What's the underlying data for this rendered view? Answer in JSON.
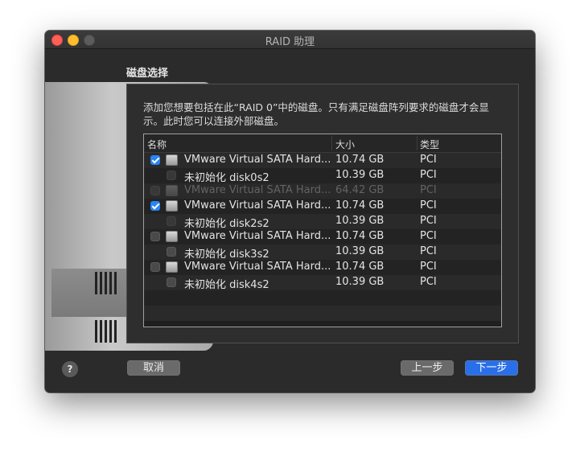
{
  "window": {
    "title": "RAID 助理"
  },
  "section_title": "磁盘选择",
  "description": "添加您想要包括在此“RAID 0”中的磁盘。只有满足磁盘阵列要求的磁盘才会显示。此时您可以连接外部磁盘。",
  "table": {
    "headers": {
      "name": "名称",
      "size": "大小",
      "type": "类型"
    },
    "rows": [
      {
        "level": 0,
        "checked": true,
        "disabled": false,
        "icon": "disk-icon",
        "name": "VMware Virtual SATA Hard...",
        "size": "10.74 GB",
        "type": "PCI"
      },
      {
        "level": 1,
        "checked": false,
        "disabled": true,
        "icon": "",
        "name": "未初始化 disk0s2",
        "size": "10.39 GB",
        "type": "PCI"
      },
      {
        "level": 0,
        "checked": false,
        "disabled": true,
        "icon": "disk-icon",
        "name": "VMware Virtual SATA Hard...",
        "size": "64.42 GB",
        "type": "PCI"
      },
      {
        "level": 0,
        "checked": true,
        "disabled": false,
        "icon": "disk-icon",
        "name": "VMware Virtual SATA Hard...",
        "size": "10.74 GB",
        "type": "PCI"
      },
      {
        "level": 1,
        "checked": false,
        "disabled": true,
        "icon": "",
        "name": "未初始化 disk2s2",
        "size": "10.39 GB",
        "type": "PCI"
      },
      {
        "level": 0,
        "checked": false,
        "disabled": false,
        "icon": "disk-icon",
        "name": "VMware Virtual SATA Hard...",
        "size": "10.74 GB",
        "type": "PCI"
      },
      {
        "level": 1,
        "checked": false,
        "disabled": false,
        "icon": "",
        "name": "未初始化 disk3s2",
        "size": "10.39 GB",
        "type": "PCI"
      },
      {
        "level": 0,
        "checked": false,
        "disabled": false,
        "icon": "disk-icon",
        "name": "VMware Virtual SATA Hard...",
        "size": "10.74 GB",
        "type": "PCI"
      },
      {
        "level": 1,
        "checked": false,
        "disabled": false,
        "icon": "",
        "name": "未初始化 disk4s2",
        "size": "10.39 GB",
        "type": "PCI"
      }
    ]
  },
  "buttons": {
    "help": "?",
    "cancel": "取消",
    "back": "上一步",
    "next": "下一步"
  },
  "colors": {
    "accent": "#2a6fea",
    "checkbox_checked": "#2a84f3",
    "close": "#fe5f57",
    "minimize": "#febc2e"
  }
}
